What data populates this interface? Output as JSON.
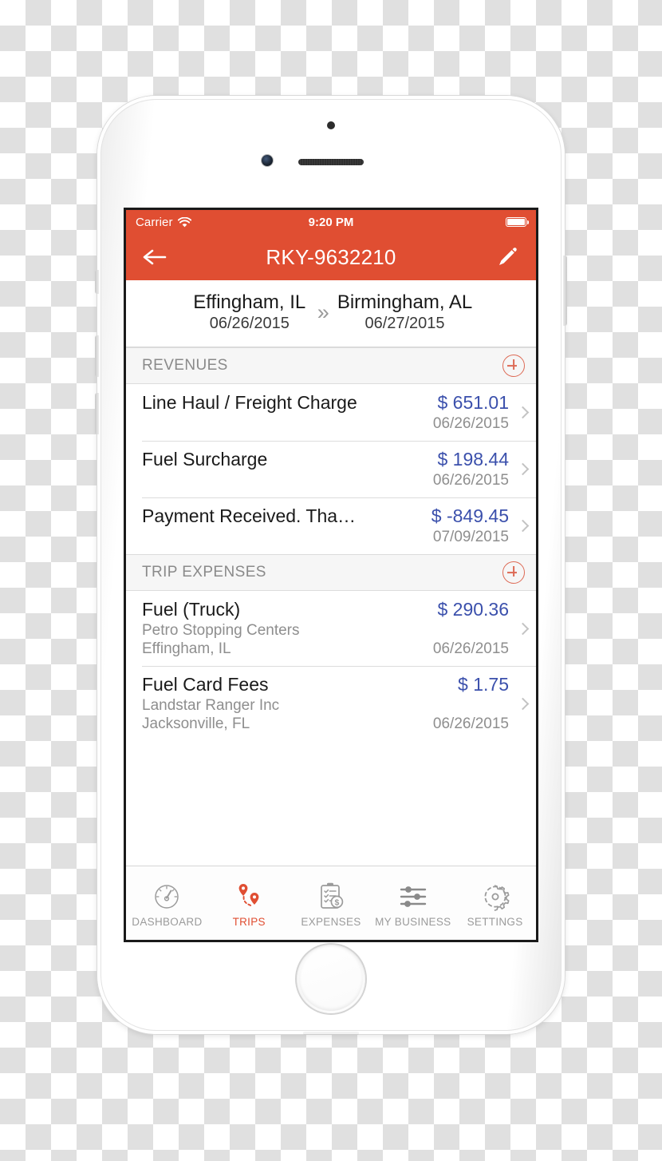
{
  "status_bar": {
    "carrier": "Carrier",
    "wifi_icon": "wifi-icon",
    "time": "9:20 PM",
    "battery_icon": "battery-full-icon"
  },
  "nav_bar": {
    "back_icon": "back-arrow-icon",
    "title": "RKY-9632210",
    "edit_icon": "pencil-icon",
    "background_color": "#E04E32"
  },
  "trip_header": {
    "origin_city": "Effingham, IL",
    "origin_date": "06/26/2015",
    "arrow_icon": "double-chevron-right-icon",
    "arrow_glyph": "»",
    "destination_city": "Birmingham, AL",
    "destination_date": "06/27/2015"
  },
  "sections": [
    {
      "title": "REVENUES",
      "add_icon": "plus-circle-icon",
      "rows": [
        {
          "title": "Line Haul / Freight Charge",
          "amount": "$ 651.01",
          "vendor": "",
          "location": "",
          "date": "06/26/2015",
          "chevron_icon": "chevron-right-icon"
        },
        {
          "title": "Fuel Surcharge",
          "amount": "$ 198.44",
          "vendor": "",
          "location": "",
          "date": "06/26/2015",
          "chevron_icon": "chevron-right-icon"
        },
        {
          "title": "Payment Received. Tha…",
          "amount": "$ -849.45",
          "vendor": "",
          "location": "",
          "date": "07/09/2015",
          "chevron_icon": "chevron-right-icon"
        }
      ]
    },
    {
      "title": "TRIP EXPENSES",
      "add_icon": "plus-circle-icon",
      "rows": [
        {
          "title": "Fuel (Truck)",
          "amount": "$ 290.36",
          "vendor": "Petro Stopping Centers",
          "location": "Effingham, IL",
          "date": "06/26/2015",
          "chevron_icon": "chevron-right-icon"
        },
        {
          "title": "Fuel Card Fees",
          "amount": "$ 1.75",
          "vendor": "Landstar Ranger Inc",
          "location": "Jacksonville, FL",
          "date": "06/26/2015",
          "chevron_icon": "chevron-right-icon"
        }
      ]
    }
  ],
  "tab_bar": {
    "active_color": "#E04E32",
    "inactive_color": "#9B9B9B",
    "tabs": [
      {
        "label": "DASHBOARD",
        "icon": "gauge-icon",
        "active": false
      },
      {
        "label": "TRIPS",
        "icon": "route-pins-icon",
        "active": true
      },
      {
        "label": "EXPENSES",
        "icon": "clipboard-dollar-icon",
        "active": false
      },
      {
        "label": "MY BUSINESS",
        "icon": "sliders-icon",
        "active": false
      },
      {
        "label": "SETTINGS",
        "icon": "gear-icon",
        "active": false
      }
    ]
  },
  "colors": {
    "accent_red": "#E04E32",
    "amount_blue": "#3B50AC",
    "section_bg": "#F6F6F6",
    "muted_text": "#8E8E8E"
  }
}
